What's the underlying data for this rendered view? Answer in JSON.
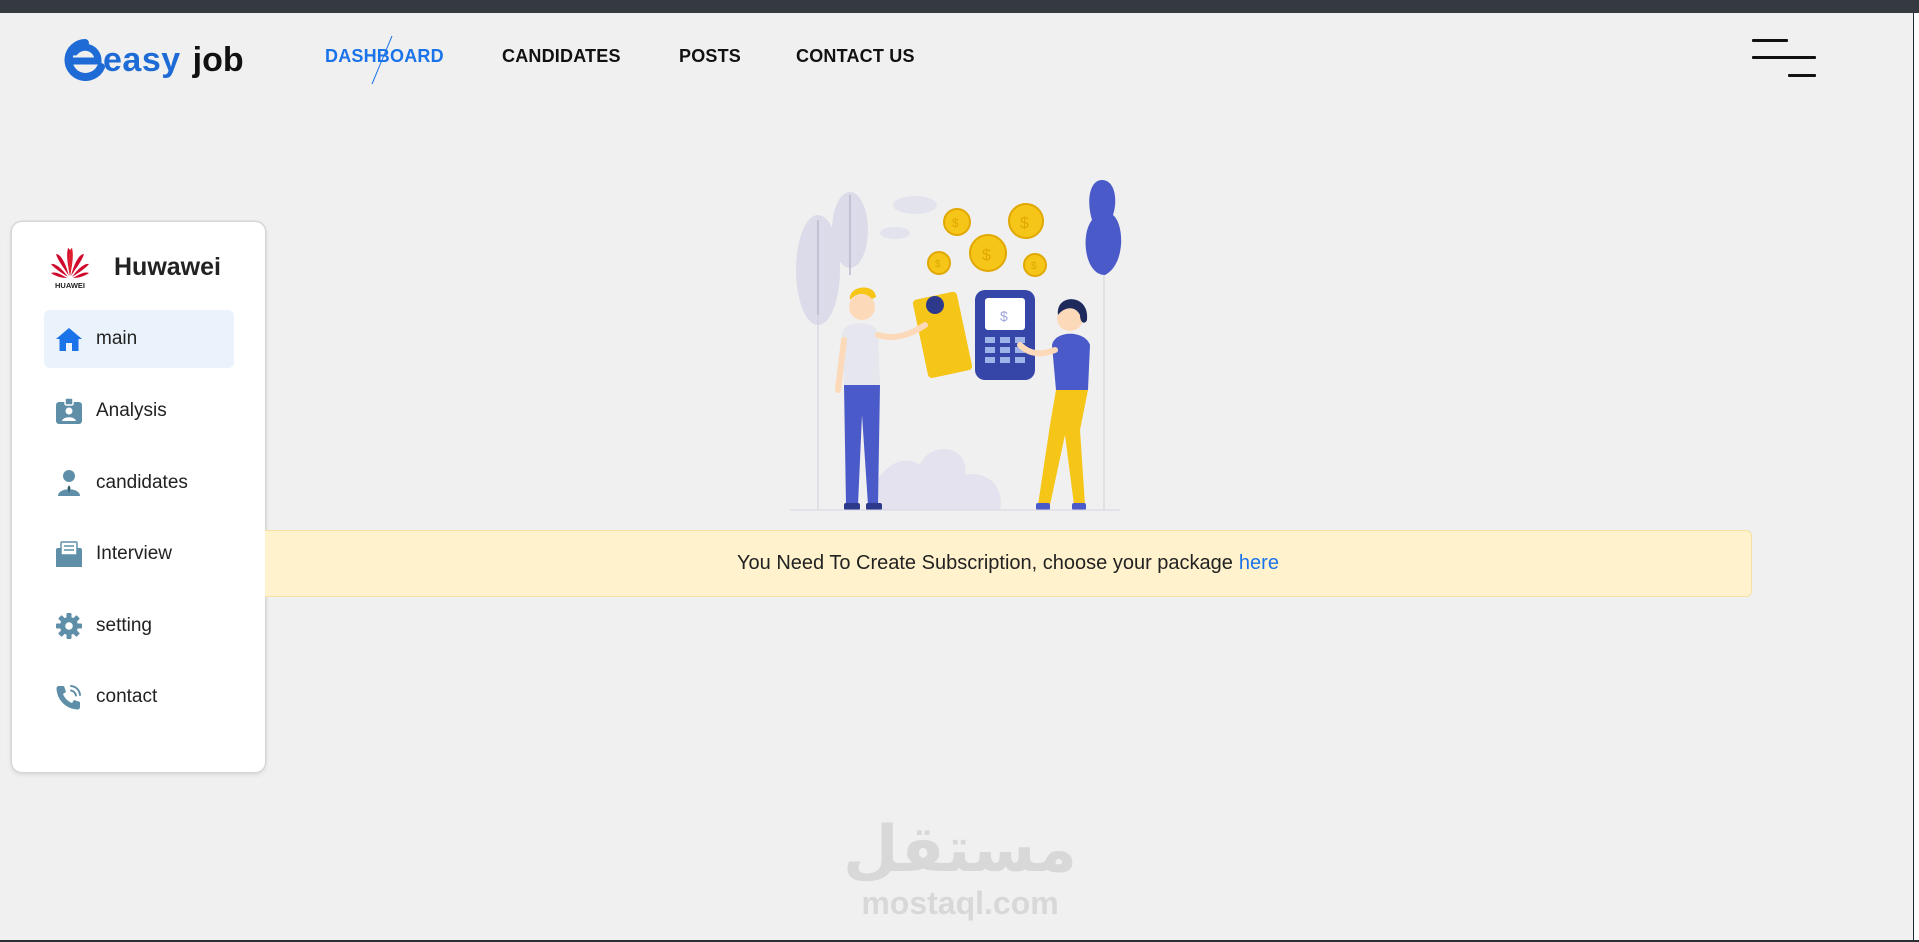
{
  "brand": {
    "easy": "easy",
    "job": "job",
    "color": "#1e6bd6"
  },
  "nav": {
    "items": [
      {
        "label": "DASHBOARD",
        "active": true
      },
      {
        "label": "CANDIDATES",
        "active": false
      },
      {
        "label": "POSTS",
        "active": false
      },
      {
        "label": "CONTACT US",
        "active": false
      }
    ],
    "active_color": "#1a73e8"
  },
  "menu_icon": "hamburger-icon",
  "sidebar": {
    "company_name": "Huwawei",
    "company_logo_text": "HUAWEI",
    "items": [
      {
        "label": "main",
        "icon": "home-icon",
        "active": true
      },
      {
        "label": "Analysis",
        "icon": "id-badge-icon",
        "active": false
      },
      {
        "label": "candidates",
        "icon": "person-icon",
        "active": false
      },
      {
        "label": "Interview",
        "icon": "envelope-icon",
        "active": false
      },
      {
        "label": "setting",
        "icon": "gear-icon",
        "active": false
      },
      {
        "label": "contact",
        "icon": "phone-icon",
        "active": false
      }
    ]
  },
  "alert": {
    "message": "You Need To Create Subscription, choose your package",
    "link_text": "here",
    "background": "#fff2cc"
  },
  "watermark": {
    "arabic": "مستقل",
    "latin": "mostaql.com"
  }
}
